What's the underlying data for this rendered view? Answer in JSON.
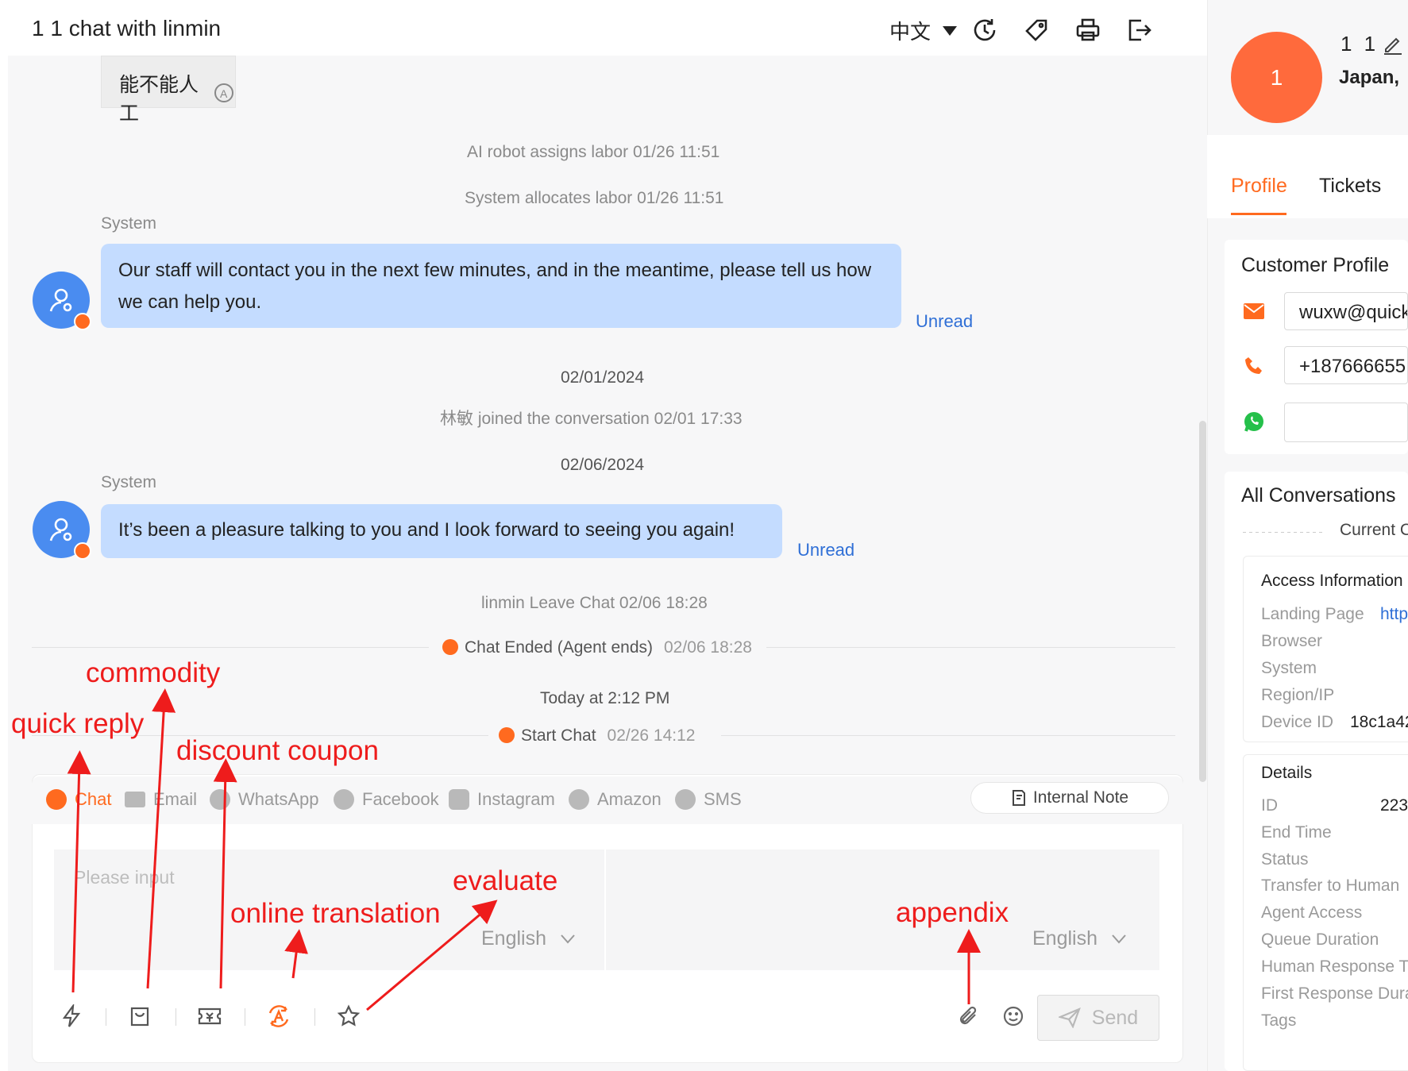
{
  "header": {
    "title": "1 1 chat with linmin",
    "language": "中文"
  },
  "messages": {
    "prev_bubble": "能不能人工",
    "ai_assign": "AI robot assigns labor  01/26 11:51",
    "sys_allocate": "System allocates labor  01/26 11:51",
    "msg1_sender": "System",
    "msg1_text": "Our staff will contact you in the next few minutes, and in the meantime, please tell us how we can help you.",
    "msg1_status": "Unread",
    "date1": "02/01/2024",
    "joined": "林敏 joined the conversation  02/01 17:33",
    "date2": "02/06/2024",
    "msg2_sender": "System",
    "msg2_text": "It’s been a pleasure talking to you and I look forward to seeing you again!",
    "msg2_status": "Unread",
    "leave": "linmin Leave Chat  02/06 18:28",
    "chat_ended": "Chat Ended (Agent ends)",
    "chat_ended_time": "02/06 18:28",
    "today": "Today at 2:12 PM",
    "start_chat": "Start Chat",
    "start_chat_time": "02/26 14:12"
  },
  "channels": [
    {
      "label": "Chat",
      "icon": "chat-icon"
    },
    {
      "label": "Email",
      "icon": "email-icon"
    },
    {
      "label": "WhatsApp",
      "icon": "whatsapp-icon"
    },
    {
      "label": "Facebook",
      "icon": "messenger-icon"
    },
    {
      "label": "Instagram",
      "icon": "instagram-icon"
    },
    {
      "label": "Amazon",
      "icon": "amazon-icon"
    },
    {
      "label": "SMS",
      "icon": "sms-icon"
    }
  ],
  "composer": {
    "internal_note": "Internal Note",
    "placeholder": "Please input",
    "source_lang": "English",
    "target_lang": "English",
    "send": "Send"
  },
  "annotations": {
    "commodity": "commodity",
    "quick_reply": "quick reply",
    "discount_coupon": "discount coupon",
    "evaluate": "evaluate",
    "online_translation": "online translation",
    "appendix": "appendix"
  },
  "right_panel": {
    "avatar_text": "1",
    "name": "1 1",
    "location": "Japan,",
    "tabs": [
      "Profile",
      "Tickets"
    ],
    "customer_profile_title": "Customer Profile",
    "email": "wuxw@quick",
    "phone": "+187666655",
    "whatsapp": "",
    "all_conversations_title": "All Conversations",
    "current_label": "Current C",
    "access_info_title": "Access Information",
    "access_labels": [
      "Landing Page",
      "Browser",
      "System",
      "Region/IP",
      "Device ID"
    ],
    "landing_value": "http",
    "device_value": "18c1a42",
    "details_title": "Details",
    "detail_labels": [
      "ID",
      "End Time",
      "Status",
      "Transfer to Human",
      "Agent Access",
      "Queue Duration",
      "Human Response T",
      "First Response Dura",
      "Tags"
    ],
    "id_value": "223"
  },
  "colors": {
    "accent": "#ff6a1f",
    "bubble": "#c4dcff",
    "link": "#2f6fd6",
    "annotation": "#ee1c1c"
  }
}
